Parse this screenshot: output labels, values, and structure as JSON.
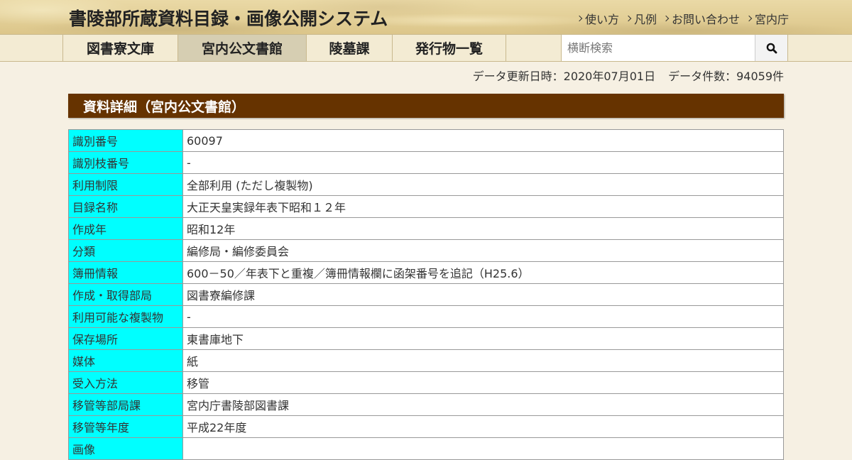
{
  "header": {
    "title": "書陵部所蔵資料目録・画像公開システム",
    "links": [
      "使い方",
      "凡例",
      "お問い合わせ",
      "宮内庁"
    ]
  },
  "nav": {
    "tabs": [
      "図書寮文庫",
      "宮内公文書館",
      "陵墓課",
      "発行物一覧"
    ],
    "active_tab": "宮内公文書館",
    "search_placeholder": "横断検索"
  },
  "info": {
    "update": "データ更新日時：2020年07月01日",
    "count": "データ件数：94059件"
  },
  "section": {
    "title": "資料詳細（宮内公文書館）"
  },
  "details": [
    {
      "label": "識別番号",
      "value": "60097"
    },
    {
      "label": "識別枝番号",
      "value": "-"
    },
    {
      "label": "利用制限",
      "value": "全部利用 (ただし複製物)"
    },
    {
      "label": "目録名称",
      "value": "大正天皇実録年表下昭和１２年"
    },
    {
      "label": "作成年",
      "value": "昭和12年"
    },
    {
      "label": "分類",
      "value": "編修局・編修委員会"
    },
    {
      "label": "簿冊情報",
      "value": "600－50／年表下と重複／簿冊情報欄に函架番号を追記（H25.6）"
    },
    {
      "label": "作成・取得部局",
      "value": "図書寮編修課"
    },
    {
      "label": "利用可能な複製物",
      "value": "-"
    },
    {
      "label": "保存場所",
      "value": "東書庫地下"
    },
    {
      "label": "媒体",
      "value": "紙"
    },
    {
      "label": "受入方法",
      "value": "移管"
    },
    {
      "label": "移管等部局課",
      "value": "宮内庁書陵部図書課"
    },
    {
      "label": "移管等年度",
      "value": "平成22年度"
    },
    {
      "label": "画像",
      "value": ""
    }
  ],
  "colors": {
    "section_bg": "#663300",
    "label_bg": "#00ffff",
    "active_tab_bg": "#d6ceb2"
  },
  "icons": {
    "search_button": "search-icon",
    "link_marker": "chevron-right-icon"
  }
}
